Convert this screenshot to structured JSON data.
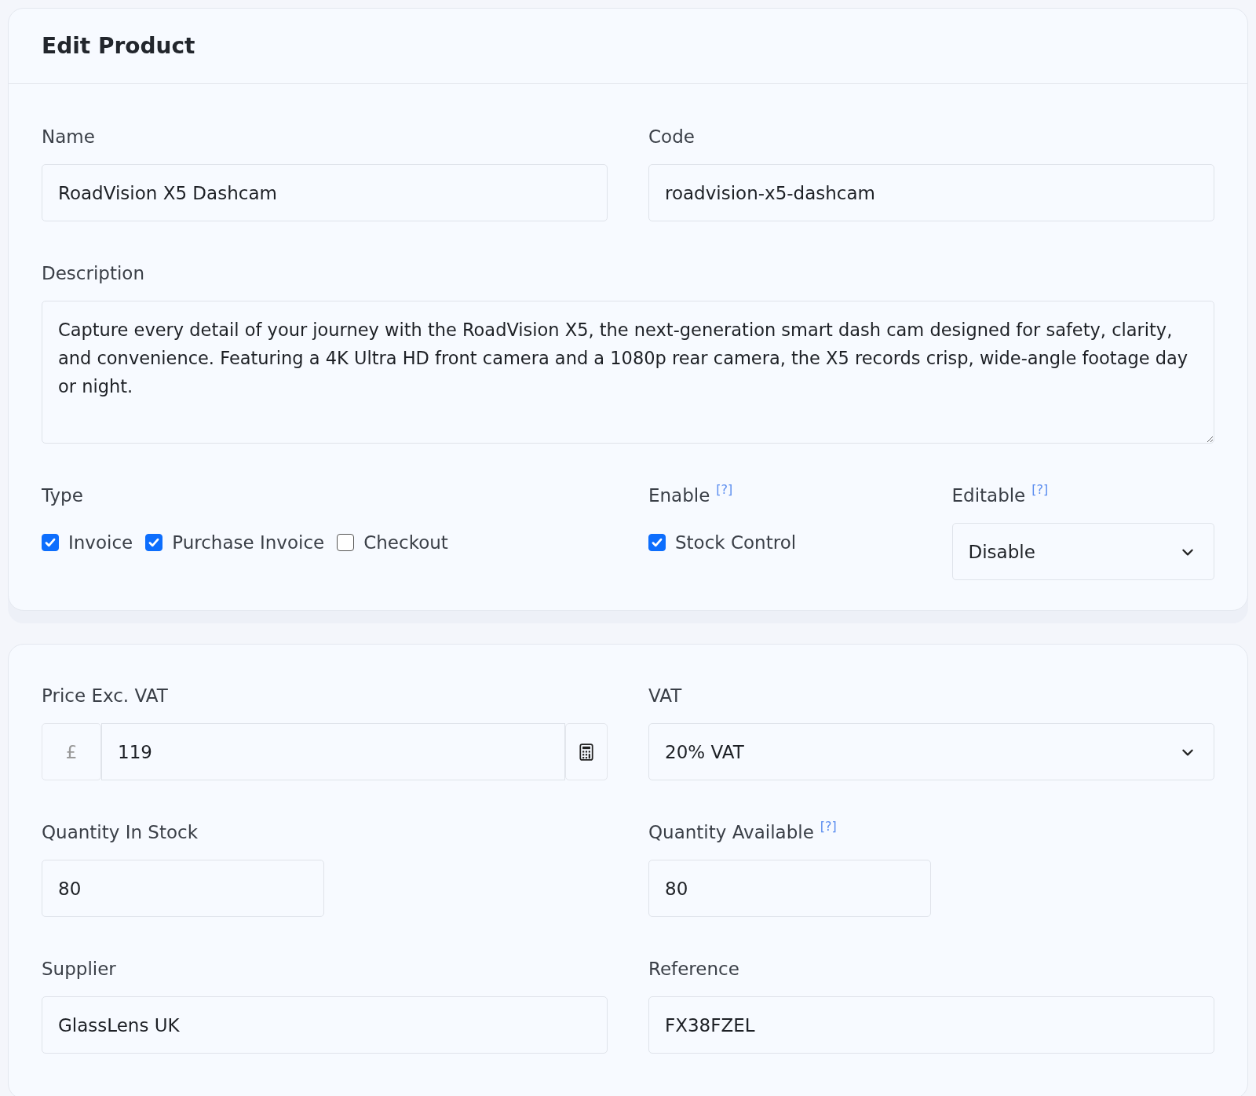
{
  "card_title": "Edit Product",
  "name": {
    "label": "Name",
    "value": "RoadVision X5 Dashcam"
  },
  "code": {
    "label": "Code",
    "value": "roadvision-x5-dashcam"
  },
  "description": {
    "label": "Description",
    "value": "Capture every detail of your journey with the RoadVision X5, the next-generation smart dash cam designed for safety, clarity, and convenience. Featuring a 4K Ultra HD front camera and a 1080p rear camera, the X5 records crisp, wide-angle footage day or night."
  },
  "type": {
    "label": "Type",
    "options": [
      {
        "label": "Invoice",
        "checked": true
      },
      {
        "label": "Purchase Invoice",
        "checked": true
      },
      {
        "label": "Checkout",
        "checked": false
      }
    ]
  },
  "enable": {
    "label": "Enable",
    "help": "[?]",
    "options": [
      {
        "label": "Stock Control",
        "checked": true
      }
    ]
  },
  "editable": {
    "label": "Editable",
    "help": "[?]",
    "value": "Disable"
  },
  "price": {
    "label": "Price Exc. VAT",
    "currency": "£",
    "value": "119"
  },
  "vat": {
    "label": "VAT",
    "value": "20% VAT"
  },
  "quantity_in_stock": {
    "label": "Quantity In Stock",
    "value": "80"
  },
  "quantity_available": {
    "label": "Quantity Available",
    "help": "[?]",
    "value": "80"
  },
  "supplier": {
    "label": "Supplier",
    "value": "GlassLens UK"
  },
  "reference": {
    "label": "Reference",
    "value": "FX38FZEL"
  }
}
